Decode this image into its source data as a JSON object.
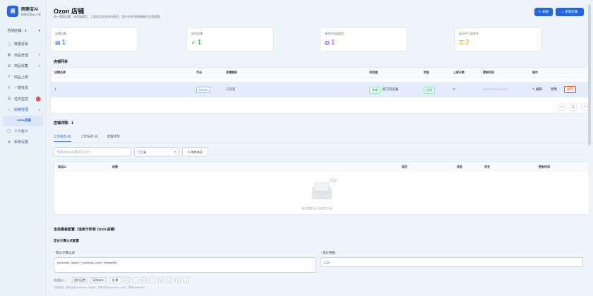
{
  "brand": {
    "name": "跨鹿宝AI",
    "subtitle": "智能卖家云上阵",
    "logo": "鹿"
  },
  "shop_select": {
    "label": "当前店铺：1"
  },
  "nav": [
    {
      "label": "数据看板",
      "icon": "dashboard-icon",
      "glyph": "▢"
    },
    {
      "label": "商品管理",
      "icon": "goods-icon",
      "glyph": "▦",
      "chev": "▾"
    },
    {
      "label": "商品采集",
      "icon": "collect-icon",
      "glyph": "⊞",
      "chev": "▾"
    },
    {
      "label": "商品上架",
      "icon": "upload-icon",
      "glyph": "⇪"
    },
    {
      "label": "一键找货",
      "icon": "search-goods-icon",
      "glyph": "⚲"
    },
    {
      "label": "任务监控",
      "icon": "monitor-icon",
      "glyph": "▤",
      "badge": "1"
    },
    {
      "label": "店铺管理",
      "icon": "shop-icon",
      "glyph": "⌂",
      "chev": "▴"
    }
  ],
  "nav_sub": {
    "label": "ozon店铺"
  },
  "nav_bottom": [
    {
      "label": "个人账户",
      "icon": "user-icon",
      "glyph": "◯"
    },
    {
      "label": "系统设置",
      "icon": "settings-icon",
      "glyph": "⚙"
    }
  ],
  "page": {
    "title": "Ozon 店铺",
    "desc": "统一管理店铺、浏览器绑定、上架商品任务执行情况，定价/仓库/物流模板为全局配置。"
  },
  "header_buttons": {
    "refresh": "刷新",
    "add": "新增店铺",
    "refresh_icon": "↻",
    "add_icon": "+"
  },
  "stats": [
    {
      "label": "店铺总数",
      "value": "1",
      "icon": "store-count-icon",
      "glyph": "▤",
      "color": "#2563eb"
    },
    {
      "label": "启用店铺",
      "value": "1",
      "icon": "check-circle-icon",
      "glyph": "✓",
      "color": "#16a34a"
    },
    {
      "label": "有效浏览器绑定",
      "value": "1",
      "icon": "globe-icon",
      "glyph": "◍",
      "color": "#7c3aed"
    },
    {
      "label": "运行中上架任务",
      "value": "2",
      "icon": "list-icon",
      "glyph": "☰",
      "color": "#f59e0b"
    }
  ],
  "shop_list": {
    "title": "店铺列表",
    "columns": [
      "店铺名称",
      "平台",
      "店铺链接",
      "浏览器",
      "状态",
      "上架计数",
      "更新时间",
      "操作"
    ],
    "row": {
      "name": "1",
      "platform": "OZON",
      "link": "未配置",
      "browser_tag": "有效",
      "browser": "新刀浏览器",
      "status": "启用",
      "count": "0",
      "updated": "2024/7/28 12:20:34",
      "edit": "编辑",
      "disable": "禁用",
      "delete": "删除"
    },
    "pager": {
      "prev": "‹",
      "page": "1",
      "next": "›"
    }
  },
  "detail": {
    "title": "店铺详情：1",
    "tabs": [
      "上架商品 (0)",
      "上架任务 (2)",
      "配置体检"
    ],
    "search_placeholder": "搜索商品ID/标题/型号/货号",
    "status_select": "已上架",
    "refresh_goods": "刷新商品",
    "columns": [
      "商品ID",
      "标题",
      "类目",
      "状态",
      "货号",
      "更新时间"
    ],
    "empty": "该店铺暂无上架商品记录"
  },
  "template": {
    "title": "全局模板配置（适用于所有 Ozon 店铺）",
    "subtitle": "定价计算公式配置",
    "formula_label": "售价计算公式",
    "formula_value": "(domestic_freight + purchase_cost) * (multiplier)",
    "multiplier_label": "售价倍数",
    "multiplier_value": "4.29",
    "quick_insert": "快速插入：",
    "chips": [
      "国内运费",
      "采购成本",
      "倍 数",
      "+",
      "-",
      "×",
      "÷",
      "(",
      ")",
      "[",
      "]"
    ],
    "hint": "可用变量：国内运费(domestic_freight)，采购成本(purchase_cost)，倍数(multiplier)"
  }
}
